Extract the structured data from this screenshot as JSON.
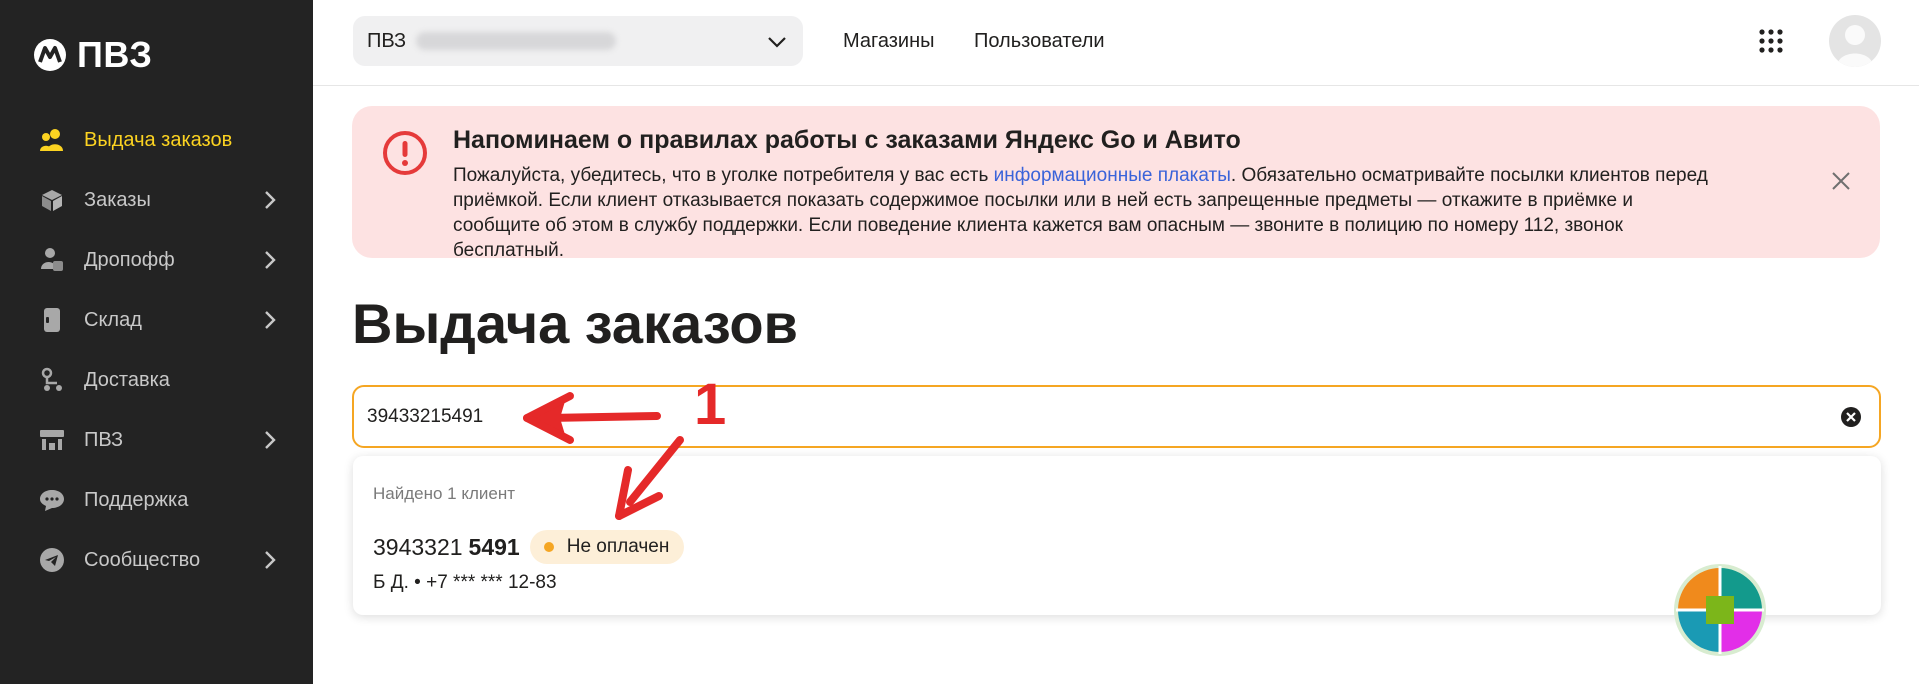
{
  "app": {
    "title": "ПВЗ"
  },
  "sidebar": {
    "items": [
      {
        "label": "Выдача заказов",
        "icon": "users-icon",
        "active": true,
        "has_chevron": false
      },
      {
        "label": "Заказы",
        "icon": "box-icon",
        "active": false,
        "has_chevron": true
      },
      {
        "label": "Дропофф",
        "icon": "dropoff-icon",
        "active": false,
        "has_chevron": true
      },
      {
        "label": "Склад",
        "icon": "warehouse-icon",
        "active": false,
        "has_chevron": true
      },
      {
        "label": "Доставка",
        "icon": "delivery-icon",
        "active": false,
        "has_chevron": false
      },
      {
        "label": "ПВЗ",
        "icon": "store-icon",
        "active": false,
        "has_chevron": true
      },
      {
        "label": "Поддержка",
        "icon": "chat-icon",
        "active": false,
        "has_chevron": false
      },
      {
        "label": "Сообщество",
        "icon": "telegram-icon",
        "active": false,
        "has_chevron": true
      }
    ]
  },
  "header": {
    "pvz_prefix": "ПВЗ",
    "links": [
      "Магазины",
      "Пользователи"
    ]
  },
  "notice": {
    "title": "Напоминаем о правилах работы с заказами Яндекс Go и Авито",
    "text_before_link": "Пожалуйста, убедитесь, что в уголке потребителя у вас есть ",
    "link_text": "информационные плакаты",
    "text_after_link": ". Обязательно осматривайте посылки клиентов перед приёмкой. Если клиент отказывается показать содержимое посылки или в ней есть запрещенные предметы — откажите в приёмке и сообщите об этом в службу поддержки. Если поведение клиента кажется вам опасным — звоните в полицию по номеру 112, звонок бесплатный."
  },
  "page": {
    "title": "Выдача заказов"
  },
  "search": {
    "value": "39433215491"
  },
  "results": {
    "found_label": "Найдено 1 клиент",
    "items": [
      {
        "number_prefix": "3943321",
        "number_suffix": "5491",
        "status": "Не оплачен",
        "status_color": "#f5a623",
        "client": "Б Д. • +7 *** *** 12-83"
      }
    ]
  },
  "annotation": {
    "step_number": "1",
    "color": "#e52929"
  },
  "colors": {
    "sidebar_bg": "#232323",
    "accent": "#fcd321",
    "notice_bg": "#fde2e2",
    "search_border": "#f5a623",
    "link": "#3a63d9"
  }
}
